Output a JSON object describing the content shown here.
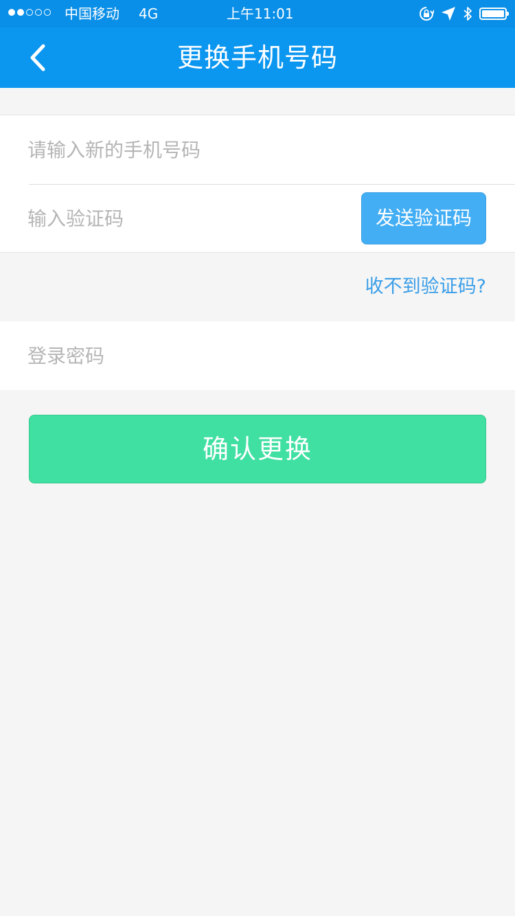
{
  "status_bar": {
    "carrier": "中国移动",
    "network": "4G",
    "time": "上午11:01",
    "signal_filled": 2,
    "signal_total": 5,
    "icons": [
      "rotation-lock-icon",
      "location-arrow-icon",
      "bluetooth-icon",
      "battery-icon"
    ]
  },
  "nav": {
    "title": "更换手机号码",
    "back_icon": "chevron-left-icon"
  },
  "form": {
    "phone_placeholder": "请输入新的手机号码",
    "code_placeholder": "输入验证码",
    "send_code_label": "发送验证码",
    "help_link": "收不到验证码?",
    "password_placeholder": "登录密码",
    "confirm_label": "确认更换"
  },
  "colors": {
    "nav_bar": "#0b96f0",
    "status_bar": "#0a8fe8",
    "send_button": "#44aef5",
    "confirm_button": "#40dfa2",
    "link": "#3a9ee8",
    "background": "#f5f5f5"
  }
}
